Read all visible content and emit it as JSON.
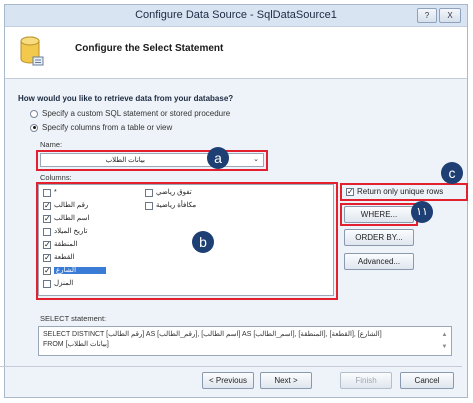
{
  "window": {
    "title": "Configure Data Source - SqlDataSource1",
    "help_label": "?",
    "close_label": "X"
  },
  "header": {
    "title": "Configure the Select Statement"
  },
  "question": "How would you like to retrieve data from your database?",
  "options": {
    "custom": "Specify a custom SQL statement or stored procedure",
    "columns": "Specify columns from a table or view"
  },
  "name": {
    "label": "Name:",
    "value": "بيانات الطلاب"
  },
  "columns": {
    "label": "Columns:",
    "left": [
      {
        "label": "*",
        "checked": ""
      },
      {
        "label": "رقم الطالب",
        "checked": "✓"
      },
      {
        "label": "اسم الطالب",
        "checked": "✓"
      },
      {
        "label": "تاريخ الميلاد",
        "checked": ""
      },
      {
        "label": "المنطقة",
        "checked": "✓"
      },
      {
        "label": "القطعة",
        "checked": "✓"
      },
      {
        "label": "الشارع",
        "checked": "✓"
      },
      {
        "label": "المنزل",
        "checked": ""
      }
    ],
    "right": [
      {
        "label": "تفوق رياضي",
        "checked": ""
      },
      {
        "label": "مكافأة رياضية",
        "checked": ""
      }
    ]
  },
  "unique_rows": {
    "label": "Return only unique rows",
    "checked": "✓"
  },
  "buttons": {
    "where": "WHERE...",
    "order_by": "ORDER BY...",
    "advanced": "Advanced...",
    "previous": "< Previous",
    "next": "Next >",
    "finish": "Finish",
    "cancel": "Cancel"
  },
  "sql": {
    "label": "SELECT statement:",
    "line1": "SELECT DISTINCT [رقم الطالب] AS [رقم_الطالب], [اسم الطالب] AS [اسم_الطالب], [المنطقة], [القطعة], [الشارع]",
    "line2": "FROM [بيانات الطلاب]",
    "scroll_up": "▲",
    "scroll_down": "▼"
  },
  "markers": {
    "a": "a",
    "b": "b",
    "c": "c",
    "n11": "١١"
  },
  "colors": {
    "highlight": "#e3202e",
    "marker": "#1d3f73",
    "selection": "#3a7bd5"
  }
}
